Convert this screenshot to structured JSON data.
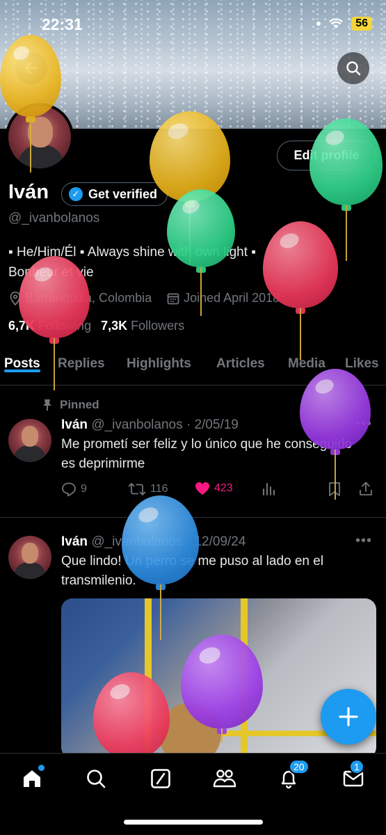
{
  "status_bar": {
    "time": "22:31",
    "battery": "56"
  },
  "profile": {
    "name": "Iván",
    "verify_label": "Get verified",
    "handle": "@_ivanbolanos",
    "edit_label": "Edit profile",
    "bio_line1": "▪ He/Him/Él ▪ Always shine with own light ▪",
    "bio_line2": "Bonheur et vie",
    "location": "Barranquilla, Colombia",
    "joined": "Joined April 2018",
    "following_count": "6,7K",
    "following_label": "Following",
    "followers_count": "7,3K",
    "followers_label": "Followers"
  },
  "tabs": [
    "Posts",
    "Replies",
    "Highlights",
    "Articles",
    "Media",
    "Likes"
  ],
  "posts": [
    {
      "pinned_label": "Pinned",
      "name": "Iván",
      "handle": "@_ivanbolanos",
      "date": "· 2/05/19",
      "text": "Me prometí ser feliz y lo único que he conseguido es deprimirme",
      "replies": "9",
      "reposts": "116",
      "likes": "423"
    },
    {
      "name": "Iván",
      "handle": "@_ivanbolanos",
      "date": "· 12/09/24",
      "text": "Que lindo! Un perro se me puso al lado en el transmilenio."
    }
  ],
  "bottom_nav": {
    "notifications_badge": "20",
    "messages_badge": "1"
  },
  "icons": [
    "back-arrow-icon",
    "search-icon",
    "verified-badge-icon",
    "location-icon",
    "calendar-icon",
    "pin-icon",
    "reply-icon",
    "repost-icon",
    "heart-icon",
    "views-icon",
    "bookmark-icon",
    "share-icon",
    "more-icon",
    "compose-plus-icon",
    "home-icon",
    "grok-icon",
    "communities-icon",
    "bell-icon",
    "mail-icon"
  ],
  "colors": {
    "accent": "#1d9bf0",
    "like": "#f91880",
    "muted": "#71767b",
    "background": "#000000"
  }
}
